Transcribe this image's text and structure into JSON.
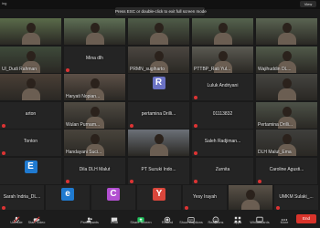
{
  "topbar": {
    "recording_label": "ing",
    "fullscreen_notice": "Press ESC or double-click to exit full screen mode",
    "view_label": "View"
  },
  "participants": [
    {
      "name": "",
      "type": "video",
      "color": "#5a6b4a"
    },
    {
      "name": "",
      "type": "video",
      "color": "#5e6f55"
    },
    {
      "name": "",
      "type": "video",
      "color": "#4f5c48"
    },
    {
      "name": "",
      "type": "video",
      "color": "#55634e"
    },
    {
      "name": "",
      "type": "video",
      "color": "#5a6452"
    },
    {
      "name": "Ul_Dudi Rahman",
      "type": "video",
      "color": "#3e4a3a"
    },
    {
      "name": "Mina dlh",
      "type": "plain"
    },
    {
      "name": "PRMN_sugiharto",
      "type": "video",
      "color": "#4b4640"
    },
    {
      "name": "PTTBP_Rati Yul...",
      "type": "video",
      "color": "#5b5a52"
    },
    {
      "name": "Wajihuddin DL...",
      "type": "video",
      "color": "#515a4a"
    },
    {
      "name": "",
      "type": "video",
      "color": "#4a3f36"
    },
    {
      "name": "Haryati Nopian...",
      "type": "video",
      "color": "#5d5047"
    },
    {
      "name": "R",
      "type": "avatar",
      "avatar_color": "#6b72c4"
    },
    {
      "name": "Luluk Andriyani",
      "type": "plain"
    },
    {
      "name": "",
      "type": "video",
      "color": "#454540"
    },
    {
      "name": "arton",
      "type": "plain"
    },
    {
      "name": "Wulan Purnam...",
      "type": "video",
      "color": "#4f4a42"
    },
    {
      "name": "pertamina Drilli...",
      "type": "plain"
    },
    {
      "name": "01113832",
      "type": "plain"
    },
    {
      "name": "Pertamina Drilli...",
      "type": "video",
      "color": "#4d5248"
    },
    {
      "name": "Tonton",
      "type": "plain"
    },
    {
      "name": "Handayani Suci...",
      "type": "video",
      "color": "#49443c"
    },
    {
      "name": "",
      "type": "video",
      "color": "#6b7077"
    },
    {
      "name": "Saleh Radjiman...",
      "type": "plain"
    },
    {
      "name": "DLH Malut_Ema",
      "type": "video",
      "color": "#3f3f3c"
    },
    {
      "name": "E",
      "type": "avatar",
      "avatar_color": "#1f7ad0"
    },
    {
      "name": "Dila DLH Malut",
      "type": "plain"
    },
    {
      "name": "PT Suzuki Indo...",
      "type": "plain"
    },
    {
      "name": "Zurnita",
      "type": "plain"
    },
    {
      "name": "Caroline Agusti...",
      "type": "plain"
    },
    {
      "name": "Sarah Indria_DL...",
      "type": "plain"
    },
    {
      "name": "e",
      "type": "avatar",
      "avatar_color": "#1f7ad0"
    },
    {
      "name": "C",
      "type": "avatar",
      "avatar_color": "#b24fd1"
    },
    {
      "name": "Y",
      "type": "avatar",
      "avatar_color": "#d9463b"
    },
    {
      "name": "Yesy Irayah",
      "type": "plain"
    },
    {
      "name": "",
      "type": "video",
      "color": "#5a5248"
    },
    {
      "name": "UMKM Sulaki_...",
      "type": "plain"
    }
  ],
  "extra_labels": {
    "ui_ayu": "Ul_Ayu Anasta...",
    "pt_suzuki": "PT Suzuki Indo...",
    "dlh_malut_ema": "DLH Malut_Ema",
    "y_avatar_name": ""
  },
  "toolbar": {
    "items": [
      {
        "label": "Unmute",
        "icon": "mic-icon"
      },
      {
        "label": "Start Video",
        "icon": "video-icon"
      },
      {
        "label": "Participants",
        "icon": "participants-icon"
      },
      {
        "label": "Chat",
        "icon": "chat-icon"
      },
      {
        "label": "Share Screen",
        "icon": "share-screen-icon"
      },
      {
        "label": "Record",
        "icon": "record-icon"
      },
      {
        "label": "Show Captions",
        "icon": "captions-icon"
      },
      {
        "label": "Reactions",
        "icon": "reactions-icon"
      },
      {
        "label": "Apps",
        "icon": "apps-icon"
      },
      {
        "label": "Whiteboards",
        "icon": "whiteboard-icon"
      },
      {
        "label": "More",
        "icon": "more-icon"
      }
    ],
    "end_label": "End"
  },
  "colors": {
    "share_green": "#22c55e",
    "end_red": "#d9342b"
  }
}
